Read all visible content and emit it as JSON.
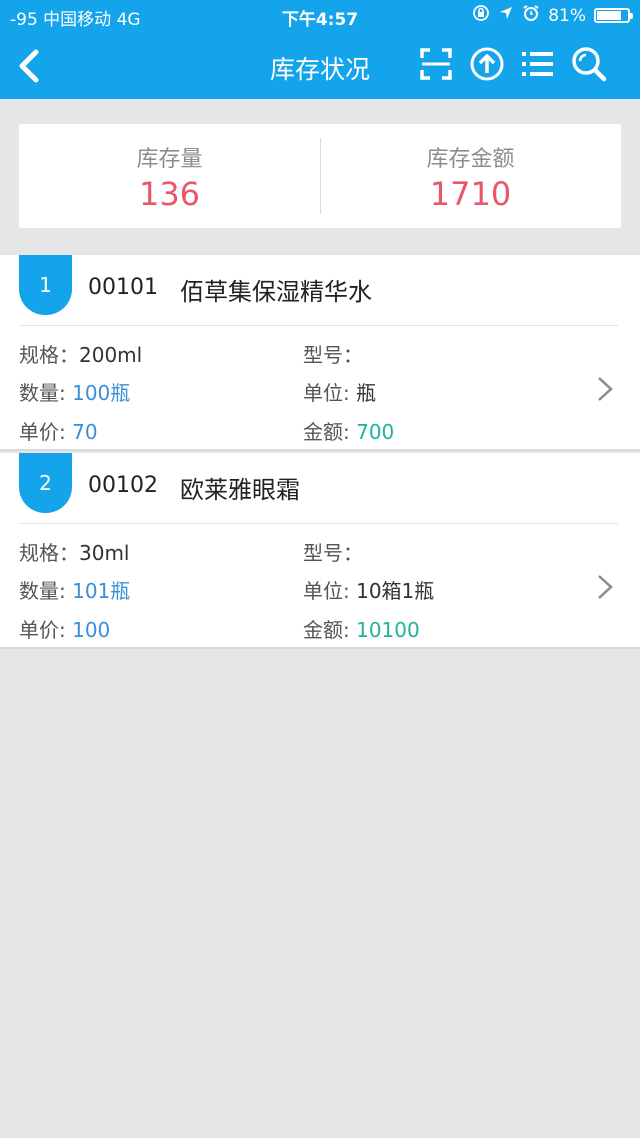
{
  "status_bar": {
    "carrier": "-95 中国移动  4G",
    "time": "下午4:57",
    "battery_pct": "81%",
    "battery_level": 0.81
  },
  "nav": {
    "title": "库存状况",
    "icons": [
      "back-chevron-icon",
      "scan-icon",
      "upload-icon",
      "list-icon",
      "search-icon"
    ]
  },
  "summary": {
    "qty_label": "库存量",
    "qty_value": "136",
    "amount_label": "库存金额",
    "amount_value": "1710"
  },
  "items": [
    {
      "index": "1",
      "code": "00101",
      "name": "佰草集保湿精华水",
      "spec_label": "规格：",
      "spec_value": "200ml",
      "model_label": "型号：",
      "model_value": "",
      "qty_label": "数量:",
      "qty_value": "100瓶",
      "unit_label": "单位:",
      "unit_value": "瓶",
      "price_label": "单价:",
      "price_value": "70",
      "amount_label": "金额:",
      "amount_value": "700"
    },
    {
      "index": "2",
      "code": "00102",
      "name": "欧莱雅眼霜",
      "spec_label": "规格：",
      "spec_value": "30ml",
      "model_label": "型号：",
      "model_value": "",
      "qty_label": "数量:",
      "qty_value": "101瓶",
      "unit_label": "单位:",
      "unit_value": "10箱1瓶",
      "price_label": "单价:",
      "price_value": "100",
      "amount_label": "金额:",
      "amount_value": "10100"
    }
  ],
  "colors": {
    "primary": "#13a4ec",
    "value_red": "#e9576a",
    "value_blue": "#3a8fd8",
    "value_green": "#1fb39a",
    "background": "#e6e6e6"
  }
}
